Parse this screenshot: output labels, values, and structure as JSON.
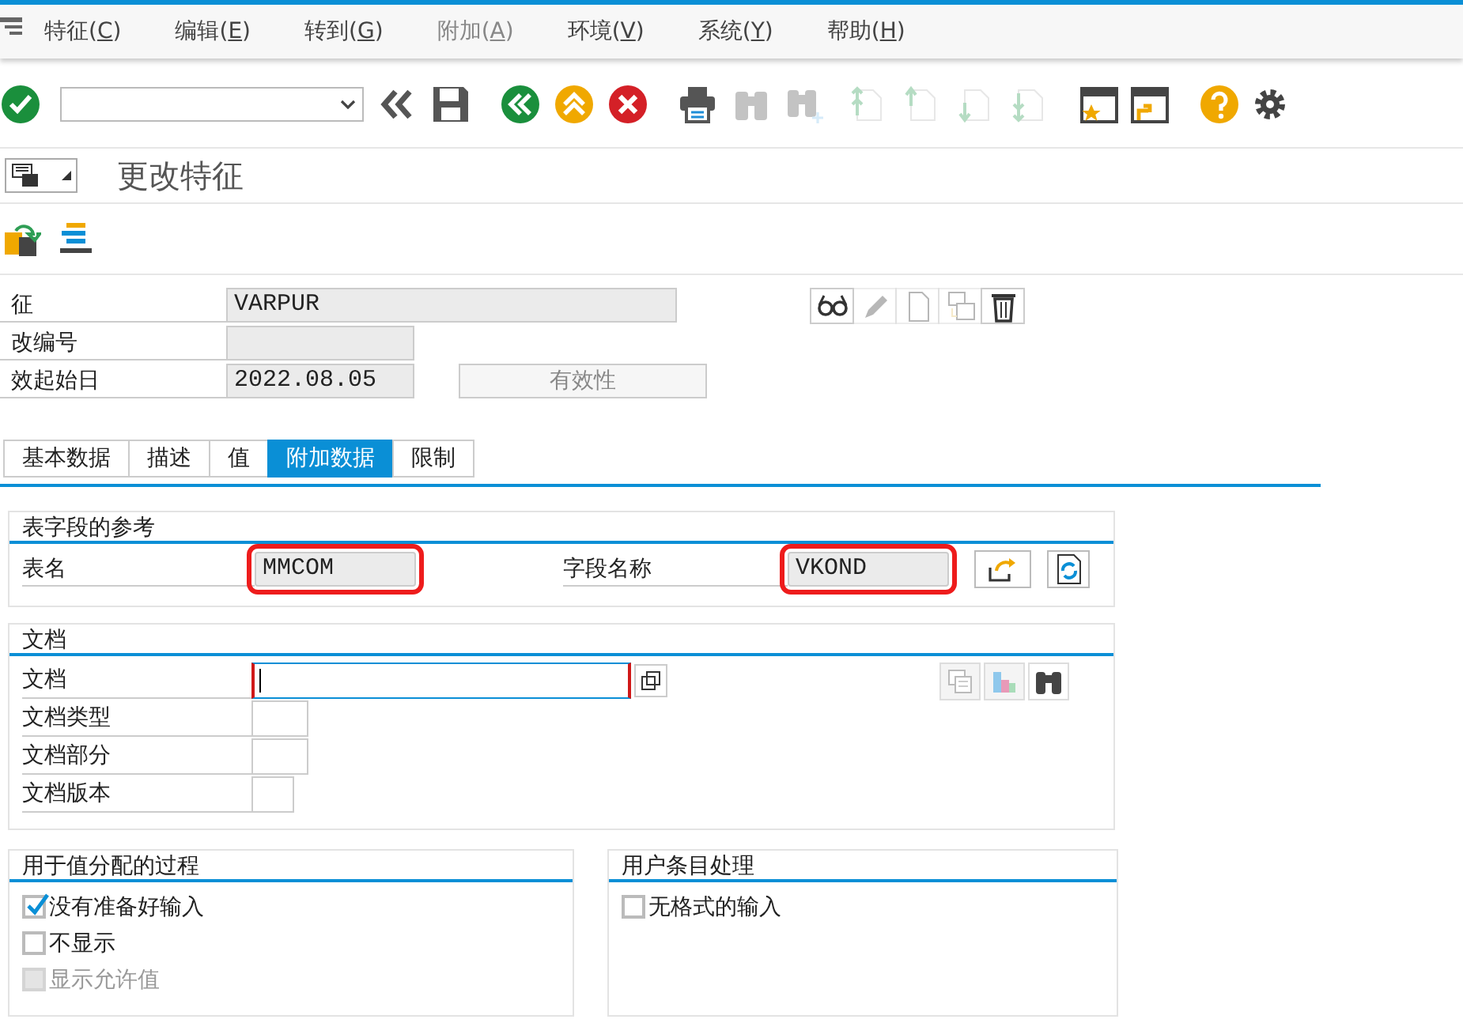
{
  "menu": [
    {
      "before": "特征(",
      "key": "C",
      "after": ")",
      "disabled": false
    },
    {
      "before": "编辑(",
      "key": "E",
      "after": ")",
      "disabled": false
    },
    {
      "before": "转到(",
      "key": "G",
      "after": ")",
      "disabled": false
    },
    {
      "before": "附加(",
      "key": "A",
      "after": ")",
      "disabled": true
    },
    {
      "before": "环境(",
      "key": "V",
      "after": ")",
      "disabled": false
    },
    {
      "before": "系统(",
      "key": "Y",
      "after": ")",
      "disabled": false
    },
    {
      "before": "帮助(",
      "key": "H",
      "after": ")",
      "disabled": false
    }
  ],
  "toolbar": [
    {
      "kind": "enter",
      "disabled": false
    },
    {
      "kind": "command-field",
      "disabled": false
    },
    {
      "kind": "collapse",
      "disabled": false
    },
    {
      "kind": "save",
      "disabled": false
    },
    {
      "kind": "back",
      "disabled": false
    },
    {
      "kind": "exit",
      "disabled": false
    },
    {
      "kind": "cancel",
      "disabled": false
    },
    {
      "kind": "print",
      "disabled": false
    },
    {
      "kind": "find",
      "disabled": true
    },
    {
      "kind": "find-next",
      "disabled": true
    },
    {
      "kind": "first-page",
      "disabled": true
    },
    {
      "kind": "previous-page",
      "disabled": true
    },
    {
      "kind": "next-page",
      "disabled": true
    },
    {
      "kind": "last-page",
      "disabled": true
    },
    {
      "kind": "new-session",
      "disabled": false
    },
    {
      "kind": "shortcut",
      "disabled": false
    },
    {
      "kind": "help",
      "disabled": false
    },
    {
      "kind": "settings",
      "disabled": false
    }
  ],
  "title": "更改特征",
  "header": {
    "fields": [
      {
        "label": "征",
        "value": "VARPUR"
      },
      {
        "label": "改编号"
      },
      {
        "label": "效起始日",
        "value": "2022.08.05"
      }
    ],
    "validity_button": {
      "label": "有效性",
      "disabled": true
    },
    "actions": [
      {
        "kind": "display",
        "disabled": false
      },
      {
        "kind": "edit",
        "disabled": true
      },
      {
        "kind": "new",
        "disabled": true
      },
      {
        "kind": "copy",
        "disabled": true
      },
      {
        "kind": "delete",
        "disabled": false
      }
    ]
  },
  "tabs": [
    {
      "label": "基本数据",
      "selected": false
    },
    {
      "label": "描述",
      "selected": false
    },
    {
      "label": "值",
      "selected": false
    },
    {
      "label": "附加数据",
      "selected": true
    },
    {
      "label": "限制",
      "selected": false
    }
  ],
  "table_reference": {
    "title": "表字段的参考",
    "table_name": {
      "label": "表名",
      "value": "MMCOM",
      "highlighted": true
    },
    "field_name": {
      "label": "字段名称",
      "value": "VKOND",
      "highlighted": true
    }
  },
  "document": {
    "title": "文档",
    "fields": [
      {
        "label": "文档",
        "focused": true
      },
      {
        "label": "文档类型",
        "focused": false
      },
      {
        "label": "文档部分",
        "focused": false
      },
      {
        "label": "文档版本",
        "focused": false
      }
    ]
  },
  "value_assignment": {
    "title": "用于值分配的过程",
    "options": [
      {
        "label": "没有准备好输入",
        "checked": true,
        "disabled": false
      },
      {
        "label": "不显示",
        "checked": false,
        "disabled": false
      },
      {
        "label": "显示允许值",
        "checked": false,
        "disabled": true
      }
    ]
  },
  "entry_handling": {
    "title": "用户条目处理",
    "options": [
      {
        "label": "无格式的输入",
        "checked": false,
        "disabled": false
      }
    ]
  }
}
